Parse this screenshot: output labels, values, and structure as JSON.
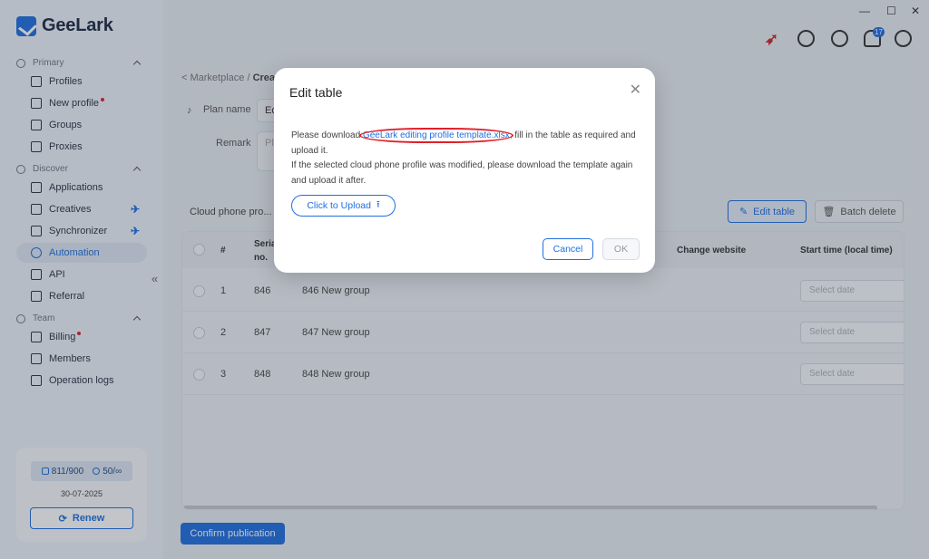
{
  "app": {
    "name": "GeeLark"
  },
  "window_controls": {
    "minimize": "—",
    "maximize": "☐",
    "close": "✕"
  },
  "topbar": {
    "notifications_count": "17"
  },
  "sidebar": {
    "sections": {
      "primary": "Primary",
      "discover": "Discover",
      "team": "Team"
    },
    "items": [
      {
        "label": "Profiles"
      },
      {
        "label": "New profile"
      },
      {
        "label": "Groups"
      },
      {
        "label": "Proxies"
      },
      {
        "label": "Applications"
      },
      {
        "label": "Creatives"
      },
      {
        "label": "Synchronizer"
      },
      {
        "label": "Automation"
      },
      {
        "label": "API"
      },
      {
        "label": "Referral"
      },
      {
        "label": "Billing"
      },
      {
        "label": "Members"
      },
      {
        "label": "Operation logs"
      }
    ],
    "collapse_icon": "«",
    "account": {
      "profiles_quota": "811/900",
      "members_quota": "50/∞",
      "expire_date": "30-07-2025",
      "renew_label": "Renew"
    }
  },
  "page": {
    "breadcrumb_parent": "< Marketplace /",
    "breadcrumb_current": "Crea",
    "plan_name_label": "Plan name",
    "plan_name_value": "Ed",
    "remark_label": "Remark",
    "remark_placeholder": "Pl",
    "cloud_phone_label": "Cloud phone pro...",
    "edit_table_label": "Edit table",
    "batch_delete_label": "Batch delete",
    "confirm_label": "Confirm publication"
  },
  "table": {
    "headers": {
      "index": "#",
      "serial_1": "Seria",
      "serial_2": "no.",
      "change_website": "Change website",
      "start_time": "Start time (local time)"
    },
    "rows": [
      {
        "index": "1",
        "serial": "846",
        "name": "846 New group",
        "date_placeholder": "Select date"
      },
      {
        "index": "2",
        "serial": "847",
        "name": "847 New group",
        "date_placeholder": "Select date"
      },
      {
        "index": "3",
        "serial": "848",
        "name": "848 New group",
        "date_placeholder": "Select date"
      }
    ]
  },
  "modal": {
    "title": "Edit table",
    "close": "✕",
    "text_before_link": "Please download ",
    "link_text": "GeeLark editing profile template.xlsx",
    "text_after_link": ", fill in the table as required and upload it.",
    "text_line_2": "If the selected cloud phone profile was modified, please download the template again and upload it after.",
    "upload_label": "Click to Upload",
    "cancel_label": "Cancel",
    "ok_label": "OK"
  },
  "colors": {
    "accent": "#1f6fe0",
    "highlight_ring": "#e0202a"
  }
}
